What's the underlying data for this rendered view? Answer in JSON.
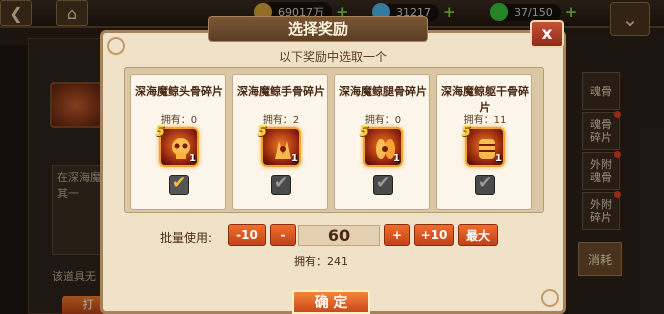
{
  "topbar": {
    "gold": "69017万",
    "diamonds": "31217",
    "energy": "37/150",
    "back_icon": "back-arrow-icon",
    "home_icon": "home-icon"
  },
  "dialog": {
    "title": "选择奖励",
    "close_label": "x",
    "subtitle": "以下奖励中选取一个",
    "options": [
      {
        "name": "深海魔鲸头骨碎片",
        "owned": "拥有：0",
        "rank": "5",
        "qty": "1",
        "checked": true
      },
      {
        "name": "深海魔鲸手骨碎片",
        "owned": "拥有：2",
        "rank": "5",
        "qty": "1",
        "checked": false
      },
      {
        "name": "深海魔鲸腿骨碎片",
        "owned": "拥有：0",
        "rank": "5",
        "qty": "1",
        "checked": false
      },
      {
        "name": "深海魔鲸躯干骨碎片",
        "owned": "拥有：11",
        "rank": "5",
        "qty": "1",
        "checked": false
      }
    ],
    "batch": {
      "label": "批量使用:",
      "minus10": "-10",
      "minus": "-",
      "value": "60",
      "plus": "+",
      "plus10": "+10",
      "max": "最大",
      "owned_total": "拥有：241"
    },
    "confirm": "确 定"
  },
  "background": {
    "desc_text": "在深海魔 选其一",
    "note_text": "该道具无",
    "action_btn": "打",
    "side_tabs": [
      "魂骨",
      "魂骨碎片",
      "外附魂骨",
      "外附碎片"
    ],
    "active_tab": "消耗"
  },
  "colors": {
    "accent": "#e9692a",
    "panel": "#efe2c8",
    "frame": "#a7815a"
  }
}
